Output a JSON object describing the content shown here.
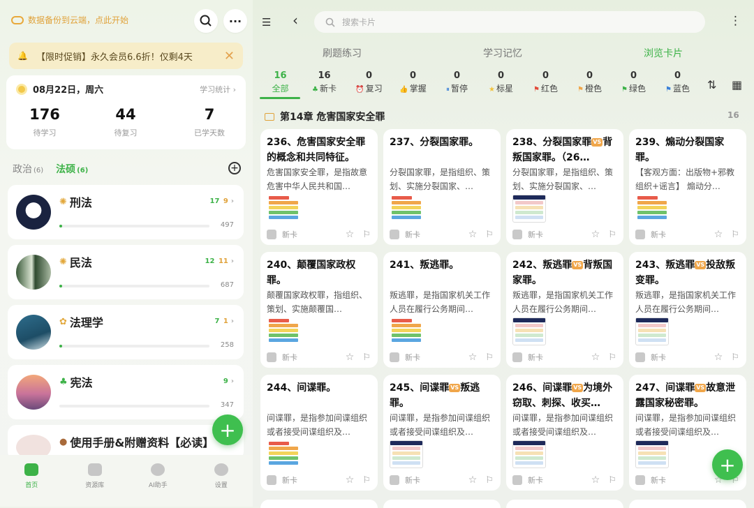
{
  "left": {
    "backup_text": "数据备份到云端，点此开始",
    "promo": {
      "text": "【限时促销】永久会员6.6折！仅剩4天"
    },
    "date": "08月22日，周六",
    "stats_link": "学习统计 ›",
    "stats": [
      {
        "value": "176",
        "label": "待学习"
      },
      {
        "value": "44",
        "label": "待复习"
      },
      {
        "value": "7",
        "label": "已学天数"
      }
    ],
    "subjects": [
      {
        "name": "政治",
        "count": "(6)"
      },
      {
        "name": "法硕",
        "count": "(6)"
      }
    ],
    "books": [
      {
        "title": "刑法",
        "c1": "17",
        "c2": "9",
        "total": "497",
        "progress": 0.02
      },
      {
        "title": "民法",
        "c1": "12",
        "c2": "11",
        "total": "687",
        "progress": 0.02
      },
      {
        "title": "法理学",
        "c1": "7",
        "c2": "1",
        "total": "258",
        "progress": 0.02
      },
      {
        "title": "宪法",
        "c1": "9",
        "c2": "",
        "total": "347",
        "progress": 0
      },
      {
        "title": "使用手册&附赠资料【必读】",
        "c1": "",
        "c2": "",
        "total": "",
        "progress": 0
      }
    ],
    "tabbar": [
      "首页",
      "资源库",
      "AI助手",
      "设置"
    ]
  },
  "right": {
    "search_placeholder": "搜索卡片",
    "top_tabs": [
      "刷题练习",
      "学习记忆",
      "浏览卡片"
    ],
    "filters": [
      {
        "count": "16",
        "label": "全部",
        "icon": ""
      },
      {
        "count": "16",
        "label": "新卡",
        "icon": "clover-icon"
      },
      {
        "count": "0",
        "label": "复习",
        "icon": "alarm-icon"
      },
      {
        "count": "0",
        "label": "掌握",
        "icon": "thumbs-up-icon"
      },
      {
        "count": "0",
        "label": "暂停",
        "icon": "pause-icon"
      },
      {
        "count": "0",
        "label": "标星",
        "icon": "star-icon"
      },
      {
        "count": "0",
        "label": "红色",
        "icon": "red-flag-icon"
      },
      {
        "count": "0",
        "label": "橙色",
        "icon": "orange-flag-icon"
      },
      {
        "count": "0",
        "label": "绿色",
        "icon": "green-flag-icon"
      },
      {
        "count": "0",
        "label": "蓝色",
        "icon": "blue-flag-icon"
      }
    ],
    "chapter": {
      "title": "第14章 危害国家安全罪",
      "count": "16"
    },
    "new_label": "新卡",
    "cards": [
      {
        "t1": "236、危害国家安全罪的概念和共同特征。",
        "vs": "",
        "t2": "",
        "excerpt": "危害国家安全罪，是指故意危害中华人民共和国…",
        "thumb": "color"
      },
      {
        "t1": "237、分裂国家罪。",
        "vs": "",
        "t2": "",
        "excerpt": "分裂国家罪，是指组织、策划、实施分裂国家、…",
        "thumb": "color"
      },
      {
        "t1": "238、分裂国家罪",
        "vs": "VS",
        "t2": "背叛国家罪。（26…",
        "excerpt": "分裂国家罪，是指组织、策划、实施分裂国家、…",
        "thumb": "table"
      },
      {
        "t1": "239、煽动分裂国家罪。",
        "vs": "",
        "t2": "",
        "excerpt": "【客观方面：出版物+邪教组织+谣言】 煽动分…",
        "thumb": "color"
      },
      {
        "t1": "240、颠覆国家政权罪。",
        "vs": "",
        "t2": "",
        "excerpt": "颠覆国家政权罪，指组织、策划、实施颠覆国…",
        "thumb": "color"
      },
      {
        "t1": "241、叛逃罪。",
        "vs": "",
        "t2": "",
        "excerpt": "叛逃罪，是指国家机关工作人员在履行公务期间…",
        "thumb": "color"
      },
      {
        "t1": "242、叛逃罪",
        "vs": "VS",
        "t2": "背叛国家罪。",
        "excerpt": "叛逃罪，是指国家机关工作人员在履行公务期间…",
        "thumb": "table"
      },
      {
        "t1": "243、叛逃罪",
        "vs": "VS",
        "t2": "投敌叛变罪。",
        "excerpt": "叛逃罪，是指国家机关工作人员在履行公务期间…",
        "thumb": "table"
      },
      {
        "t1": "244、间谍罪。",
        "vs": "",
        "t2": "",
        "excerpt": "间谍罪，是指参加间谍组织或者接受间谍组织及…",
        "thumb": "color"
      },
      {
        "t1": "245、间谍罪",
        "vs": "VS",
        "t2": "叛逃罪。",
        "excerpt": "间谍罪，是指参加间谍组织或者接受间谍组织及…",
        "thumb": "table"
      },
      {
        "t1": "246、间谍罪",
        "vs": "VS",
        "t2": "为境外窃取、刺探、收买…",
        "excerpt": "间谍罪，是指参加间谍组织或者接受间谍组织及…",
        "thumb": "table"
      },
      {
        "t1": "247、间谍罪",
        "vs": "VS",
        "t2": "故意泄露国家秘密罪。",
        "excerpt": "间谍罪，是指参加间谍组织或者接受间谍组织及…",
        "thumb": "table"
      }
    ]
  }
}
